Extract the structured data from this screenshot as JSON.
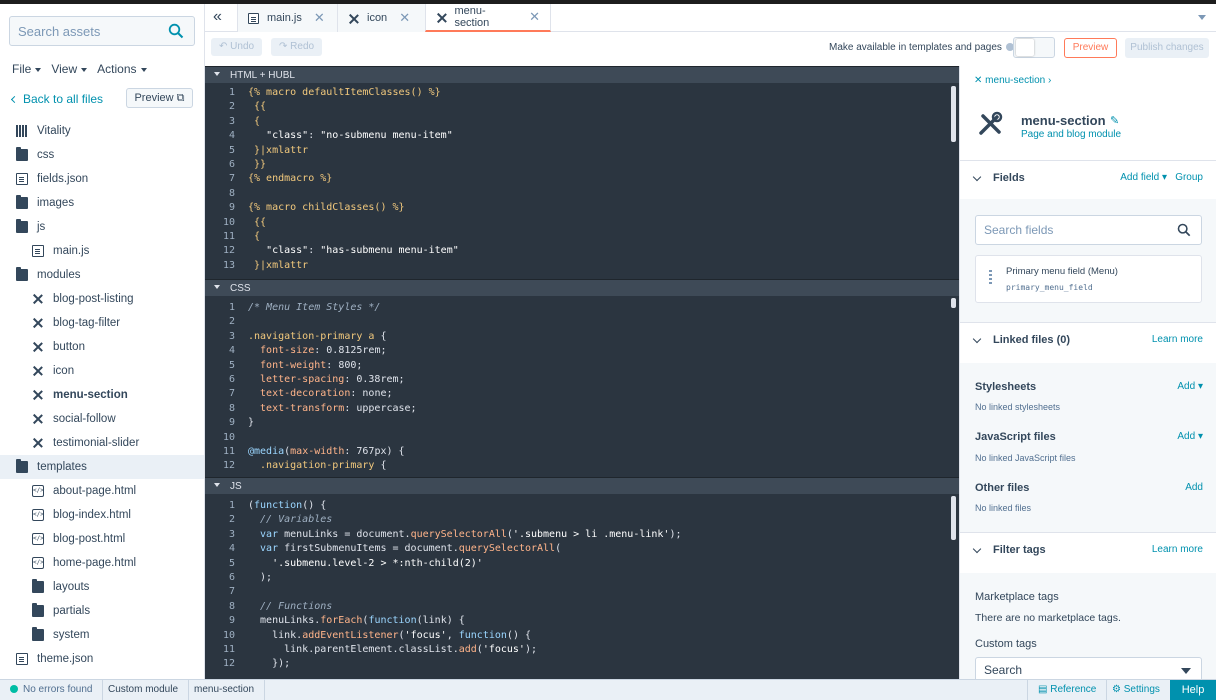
{
  "sidebar": {
    "search_placeholder": "Search assets",
    "menus": [
      "File",
      "View",
      "Actions"
    ],
    "back_link": "Back to all files",
    "preview_label": "Preview",
    "tree": [
      {
        "label": "Vitality",
        "icon": "theme-icon",
        "depth": 0
      },
      {
        "label": "css",
        "icon": "folder-icon",
        "depth": 0
      },
      {
        "label": "fields.json",
        "icon": "file-icon",
        "depth": 0
      },
      {
        "label": "images",
        "icon": "folder-icon",
        "depth": 0
      },
      {
        "label": "js",
        "icon": "folder-open-icon",
        "depth": 0
      },
      {
        "label": "main.js",
        "icon": "file-icon",
        "depth": 1
      },
      {
        "label": "modules",
        "icon": "folder-open-icon",
        "depth": 0
      },
      {
        "label": "blog-post-listing",
        "icon": "module-icon",
        "depth": 1
      },
      {
        "label": "blog-tag-filter",
        "icon": "module-icon",
        "depth": 1
      },
      {
        "label": "button",
        "icon": "module-icon",
        "depth": 1
      },
      {
        "label": "icon",
        "icon": "module-icon",
        "depth": 1
      },
      {
        "label": "menu-section",
        "icon": "module-icon",
        "depth": 1,
        "active": true
      },
      {
        "label": "social-follow",
        "icon": "module-icon",
        "depth": 1
      },
      {
        "label": "testimonial-slider",
        "icon": "module-icon",
        "depth": 1
      },
      {
        "label": "templates",
        "icon": "folder-open-icon",
        "depth": 0,
        "selected": true
      },
      {
        "label": "about-page.html",
        "icon": "code-icon",
        "depth": 1
      },
      {
        "label": "blog-index.html",
        "icon": "code-icon",
        "depth": 1
      },
      {
        "label": "blog-post.html",
        "icon": "code-icon",
        "depth": 1
      },
      {
        "label": "home-page.html",
        "icon": "code-icon",
        "depth": 1
      },
      {
        "label": "layouts",
        "icon": "folder-icon",
        "depth": 1
      },
      {
        "label": "partials",
        "icon": "folder-icon",
        "depth": 1
      },
      {
        "label": "system",
        "icon": "folder-icon",
        "depth": 1
      },
      {
        "label": "theme.json",
        "icon": "file-icon",
        "depth": 0
      }
    ]
  },
  "tabs": [
    {
      "label": "main.js",
      "icon": "file-icon"
    },
    {
      "label": "icon",
      "icon": "module-icon"
    },
    {
      "label": "menu-section",
      "icon": "module-icon",
      "active": true
    }
  ],
  "toolbar": {
    "undo": "Undo",
    "redo": "Redo",
    "make_available": "Make available in templates and pages",
    "preview": "Preview",
    "publish": "Publish changes"
  },
  "editor": {
    "panes": [
      {
        "title": "HTML + HUBL",
        "lines": [
          [
            {
              "c": "t-tag",
              "t": "{% macro defaultItemClasses() %}"
            }
          ],
          [
            {
              "c": "t-tag",
              "t": " {{"
            }
          ],
          [
            {
              "c": "t-tag",
              "t": " {"
            }
          ],
          [
            {
              "c": "t-plain",
              "t": "   "
            },
            {
              "c": "t-str",
              "t": "\"class\""
            },
            {
              "c": "t-plain",
              "t": ": "
            },
            {
              "c": "t-str",
              "t": "\"no-submenu menu-item\""
            }
          ],
          [
            {
              "c": "t-tag",
              "t": " }|xmlattr"
            }
          ],
          [
            {
              "c": "t-tag",
              "t": " }}"
            }
          ],
          [
            {
              "c": "t-tag",
              "t": "{% endmacro %}"
            }
          ],
          [],
          [
            {
              "c": "t-tag",
              "t": "{% macro childClasses() %}"
            }
          ],
          [
            {
              "c": "t-tag",
              "t": " {{"
            }
          ],
          [
            {
              "c": "t-tag",
              "t": " {"
            }
          ],
          [
            {
              "c": "t-plain",
              "t": "   "
            },
            {
              "c": "t-str",
              "t": "\"class\""
            },
            {
              "c": "t-plain",
              "t": ": "
            },
            {
              "c": "t-str",
              "t": "\"has-submenu menu-item\""
            }
          ],
          [
            {
              "c": "t-tag",
              "t": " }|xmlattr"
            }
          ]
        ]
      },
      {
        "title": "CSS",
        "lines": [
          [
            {
              "c": "t-com",
              "t": "/* Menu Item Styles */"
            }
          ],
          [],
          [
            {
              "c": "t-tag",
              "t": ".navigation-primary a"
            },
            {
              "c": "t-plain",
              "t": " {"
            }
          ],
          [
            {
              "c": "t-key",
              "t": "  font-size"
            },
            {
              "c": "t-plain",
              "t": ": 0.8125rem;"
            }
          ],
          [
            {
              "c": "t-key",
              "t": "  font-weight"
            },
            {
              "c": "t-plain",
              "t": ": 800;"
            }
          ],
          [
            {
              "c": "t-key",
              "t": "  letter-spacing"
            },
            {
              "c": "t-plain",
              "t": ": 0.38rem;"
            }
          ],
          [
            {
              "c": "t-key",
              "t": "  text-decoration"
            },
            {
              "c": "t-plain",
              "t": ": none;"
            }
          ],
          [
            {
              "c": "t-key",
              "t": "  text-transform"
            },
            {
              "c": "t-plain",
              "t": ": uppercase;"
            }
          ],
          [
            {
              "c": "t-plain",
              "t": "}"
            }
          ],
          [],
          [
            {
              "c": "t-kw",
              "t": "@media"
            },
            {
              "c": "t-plain",
              "t": "("
            },
            {
              "c": "t-key",
              "t": "max-width"
            },
            {
              "c": "t-plain",
              "t": ": 767px) {"
            }
          ],
          [
            {
              "c": "t-tag",
              "t": "  .navigation-primary"
            },
            {
              "c": "t-plain",
              "t": " {"
            }
          ]
        ]
      },
      {
        "title": "JS",
        "lines": [
          [
            {
              "c": "t-plain",
              "t": "("
            },
            {
              "c": "t-kw",
              "t": "function"
            },
            {
              "c": "t-plain",
              "t": "() {"
            }
          ],
          [
            {
              "c": "t-com",
              "t": "  // Variables"
            }
          ],
          [
            {
              "c": "t-kw",
              "t": "  var"
            },
            {
              "c": "t-plain",
              "t": " menuLinks = document."
            },
            {
              "c": "t-key",
              "t": "querySelectorAll"
            },
            {
              "c": "t-plain",
              "t": "("
            },
            {
              "c": "t-str",
              "t": "'.submenu > li .menu-link'"
            },
            {
              "c": "t-plain",
              "t": ");"
            }
          ],
          [
            {
              "c": "t-kw",
              "t": "  var"
            },
            {
              "c": "t-plain",
              "t": " firstSubmenuItems = document."
            },
            {
              "c": "t-key",
              "t": "querySelectorAll"
            },
            {
              "c": "t-plain",
              "t": "("
            }
          ],
          [
            {
              "c": "t-str",
              "t": "    '.submenu.level-2 > *:nth-child(2)'"
            }
          ],
          [
            {
              "c": "t-plain",
              "t": "  );"
            }
          ],
          [],
          [
            {
              "c": "t-com",
              "t": "  // Functions"
            }
          ],
          [
            {
              "c": "t-plain",
              "t": "  menuLinks."
            },
            {
              "c": "t-key",
              "t": "forEach"
            },
            {
              "c": "t-plain",
              "t": "("
            },
            {
              "c": "t-kw",
              "t": "function"
            },
            {
              "c": "t-plain",
              "t": "(link) {"
            }
          ],
          [
            {
              "c": "t-plain",
              "t": "    link."
            },
            {
              "c": "t-key",
              "t": "addEventListener"
            },
            {
              "c": "t-plain",
              "t": "("
            },
            {
              "c": "t-str",
              "t": "'focus'"
            },
            {
              "c": "t-plain",
              "t": ", "
            },
            {
              "c": "t-kw",
              "t": "function"
            },
            {
              "c": "t-plain",
              "t": "() {"
            }
          ],
          [
            {
              "c": "t-plain",
              "t": "      link.parentElement.classList."
            },
            {
              "c": "t-key",
              "t": "add"
            },
            {
              "c": "t-plain",
              "t": "("
            },
            {
              "c": "t-str",
              "t": "'focus'"
            },
            {
              "c": "t-plain",
              "t": ");"
            }
          ],
          [
            {
              "c": "t-plain",
              "t": "    });"
            }
          ]
        ]
      }
    ]
  },
  "rpanel": {
    "breadcrumb": "menu-section",
    "module_title": "menu-section",
    "module_subtitle": "Page and blog module",
    "fields_title": "Fields",
    "add_field": "Add field",
    "group": "Group",
    "search_fields_placeholder": "Search fields",
    "field_name": "Primary menu field (Menu)",
    "field_id": "primary_menu_field",
    "linked_title": "Linked files (0)",
    "learn_more": "Learn more",
    "stylesheets": "Stylesheets",
    "add": "Add",
    "no_stylesheets": "No linked stylesheets",
    "js_files": "JavaScript files",
    "no_js": "No linked JavaScript files",
    "other_files": "Other files",
    "no_files": "No linked files",
    "filter_title": "Filter tags",
    "marketplace": "Marketplace tags",
    "no_marketplace": "There are no marketplace tags.",
    "custom_tags": "Custom tags",
    "search": "Search"
  },
  "status": {
    "errors": "No errors found",
    "module_type": "Custom module",
    "file": "menu-section",
    "reference": "Reference",
    "settings": "Settings",
    "help": "Help"
  },
  "colors": {
    "accent": "#ff7a59",
    "link": "#0091ae",
    "editor_bg": "#2b3540",
    "ok": "#00bda5"
  }
}
